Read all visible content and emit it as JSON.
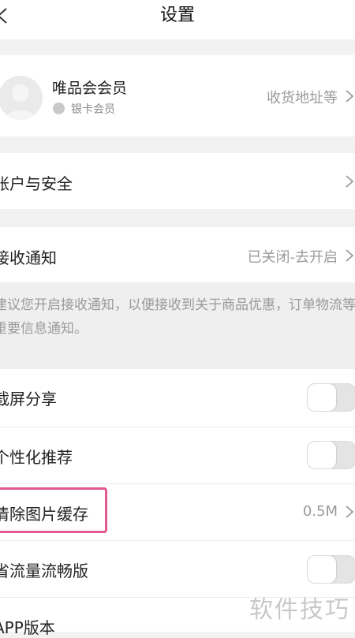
{
  "nav": {
    "title": "设置"
  },
  "profile": {
    "name": "唯品会会员",
    "level": "银卡会员",
    "address_link": "收货地址等"
  },
  "account": {
    "label": "账户与安全"
  },
  "notification": {
    "label": "接收通知",
    "status": "已关闭-去开启",
    "notice": "建议您开启接收通知，以便接收到关于商品优惠，订单物流等重要信息通知。"
  },
  "settings": [
    {
      "label": "截屏分享",
      "type": "toggle",
      "on": false
    },
    {
      "label": "个性化推荐",
      "type": "toggle",
      "on": false
    },
    {
      "label": "清除图片缓存",
      "type": "value",
      "value": "0.5M"
    },
    {
      "label": "省流量流畅版",
      "type": "toggle",
      "on": false
    },
    {
      "label": "APP版本",
      "type": "text"
    }
  ],
  "watermark": "软件技巧"
}
